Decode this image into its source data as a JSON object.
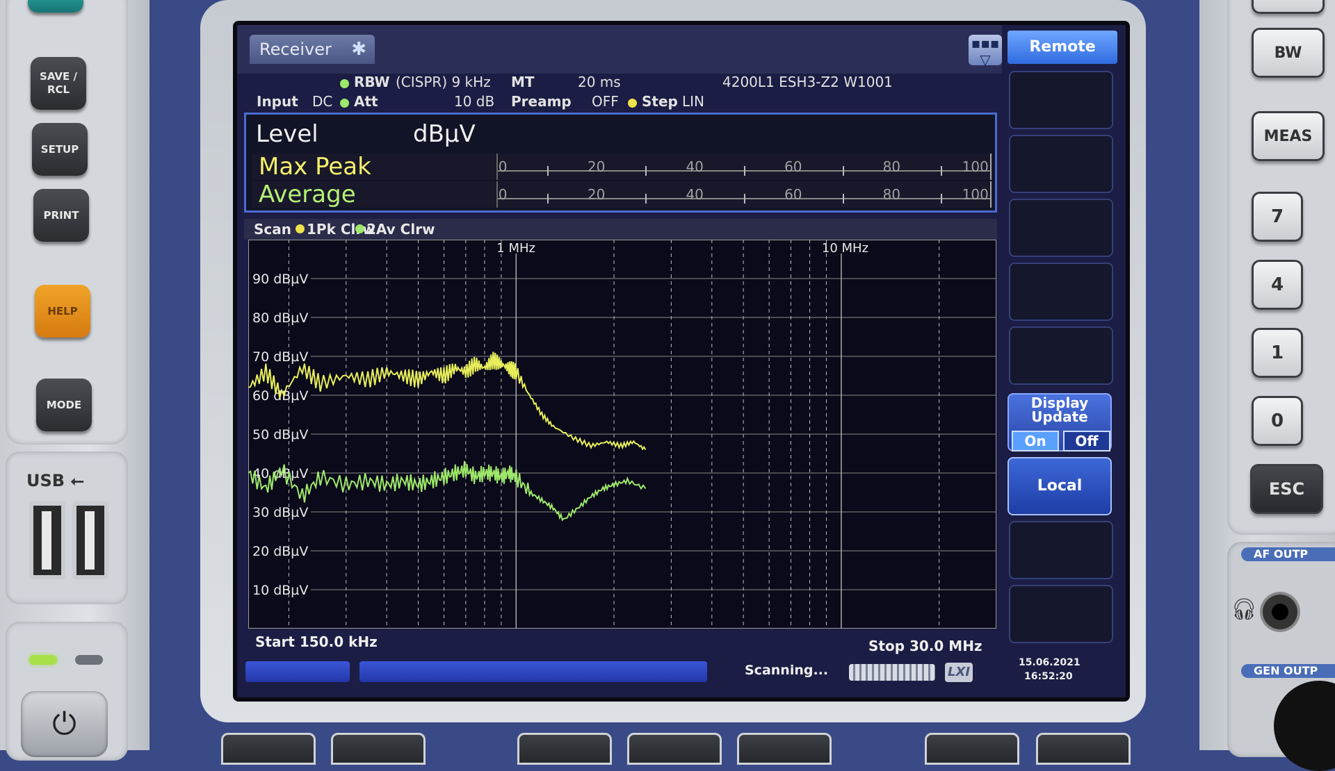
{
  "left_panel": {
    "keys": [
      "SAVE / RCL",
      "SETUP",
      "PRINT",
      "HELP",
      "MODE"
    ],
    "usb_label": "USB"
  },
  "right_panel": {
    "keys": [
      "BW",
      "MEAS",
      "7",
      "4",
      "1",
      "0",
      "ESC"
    ],
    "af_label": "AF OUTP",
    "gen_label": "GEN OUTP"
  },
  "screen": {
    "tab_label": "Receiver",
    "remote_label": "Remote",
    "header": {
      "rbw_label": "RBW",
      "rbw_value": "(CISPR) 9 kHz",
      "mt_label": "MT",
      "mt_value": "20 ms",
      "transducer": "4200L1 ESH3-Z2 W1001",
      "input_label": "Input",
      "input_value": "DC",
      "att_label": "Att",
      "att_value": "10 dB",
      "preamp_label": "Preamp",
      "preamp_value": "OFF",
      "step_label": "Step",
      "step_value": "LIN"
    },
    "level_panel": {
      "title": "Level",
      "unit": "dBµV",
      "rows": [
        {
          "name": "Max Peak",
          "color": "#f5f06a"
        },
        {
          "name": "Average",
          "color": "#b6ef74"
        }
      ],
      "scale": [
        "0",
        "20",
        "40",
        "60",
        "80",
        "100"
      ]
    },
    "scan": {
      "label": "Scan",
      "trace1": "1Pk Clrw",
      "trace2": "2Av Clrw"
    },
    "start_label": "Start 150.0 kHz",
    "stop_label": "Stop 30.0 MHz",
    "softkeys": {
      "display_update": "Display Update",
      "on": "On",
      "off": "Off",
      "local": "Local"
    },
    "status": {
      "scanning": "Scanning...",
      "lxi": "LXI",
      "date": "15.06.2021",
      "time": "16:52:20"
    }
  },
  "chart_data": {
    "type": "line",
    "xscale": "log",
    "xlim": [
      150000,
      30000000
    ],
    "ylim": [
      0,
      100
    ],
    "ylabel_ticks": [
      "90 dBµV",
      "80 dBµV",
      "70 dBµV",
      "60 dBµV",
      "50 dBµV",
      "40 dBµV",
      "30 dBµV",
      "20 dBµV",
      "10 dBµV"
    ],
    "x_tick_labels": [
      {
        "label": "1 MHz",
        "x": 1000000
      },
      {
        "label": "10 MHz",
        "x": 10000000
      }
    ],
    "grid": true,
    "series": [
      {
        "name": "1Pk Clrw",
        "color": "#e8ee5a",
        "x": [
          150000,
          170000,
          190000,
          220000,
          250000,
          300000,
          350000,
          400000,
          450000,
          500000,
          550000,
          600000,
          650000,
          700000,
          750000,
          800000,
          850000,
          900000,
          950000,
          1000000,
          1100000,
          1200000,
          1300000,
          1500000,
          1700000,
          1900000,
          2100000,
          2300000,
          2500000
        ],
        "y": [
          62,
          66,
          60,
          67,
          63,
          65,
          64,
          66,
          65,
          64,
          66,
          65,
          67,
          66,
          68,
          67,
          69,
          68,
          67,
          66,
          60,
          55,
          52,
          49,
          47,
          48,
          47,
          48,
          46
        ]
      },
      {
        "name": "2Av Clrw",
        "color": "#9ee86a",
        "x": [
          150000,
          170000,
          190000,
          220000,
          250000,
          300000,
          350000,
          400000,
          450000,
          500000,
          550000,
          600000,
          650000,
          700000,
          750000,
          800000,
          850000,
          900000,
          950000,
          1000000,
          1100000,
          1200000,
          1300000,
          1400000,
          1550000,
          1700000,
          1850000,
          2000000,
          2200000,
          2500000
        ],
        "y": [
          40,
          36,
          41,
          34,
          39,
          37,
          38,
          37,
          38,
          37,
          38,
          39,
          40,
          41,
          39,
          40,
          40,
          39,
          40,
          39,
          35,
          33,
          31,
          28,
          31,
          34,
          36,
          37,
          38,
          36
        ]
      }
    ]
  }
}
